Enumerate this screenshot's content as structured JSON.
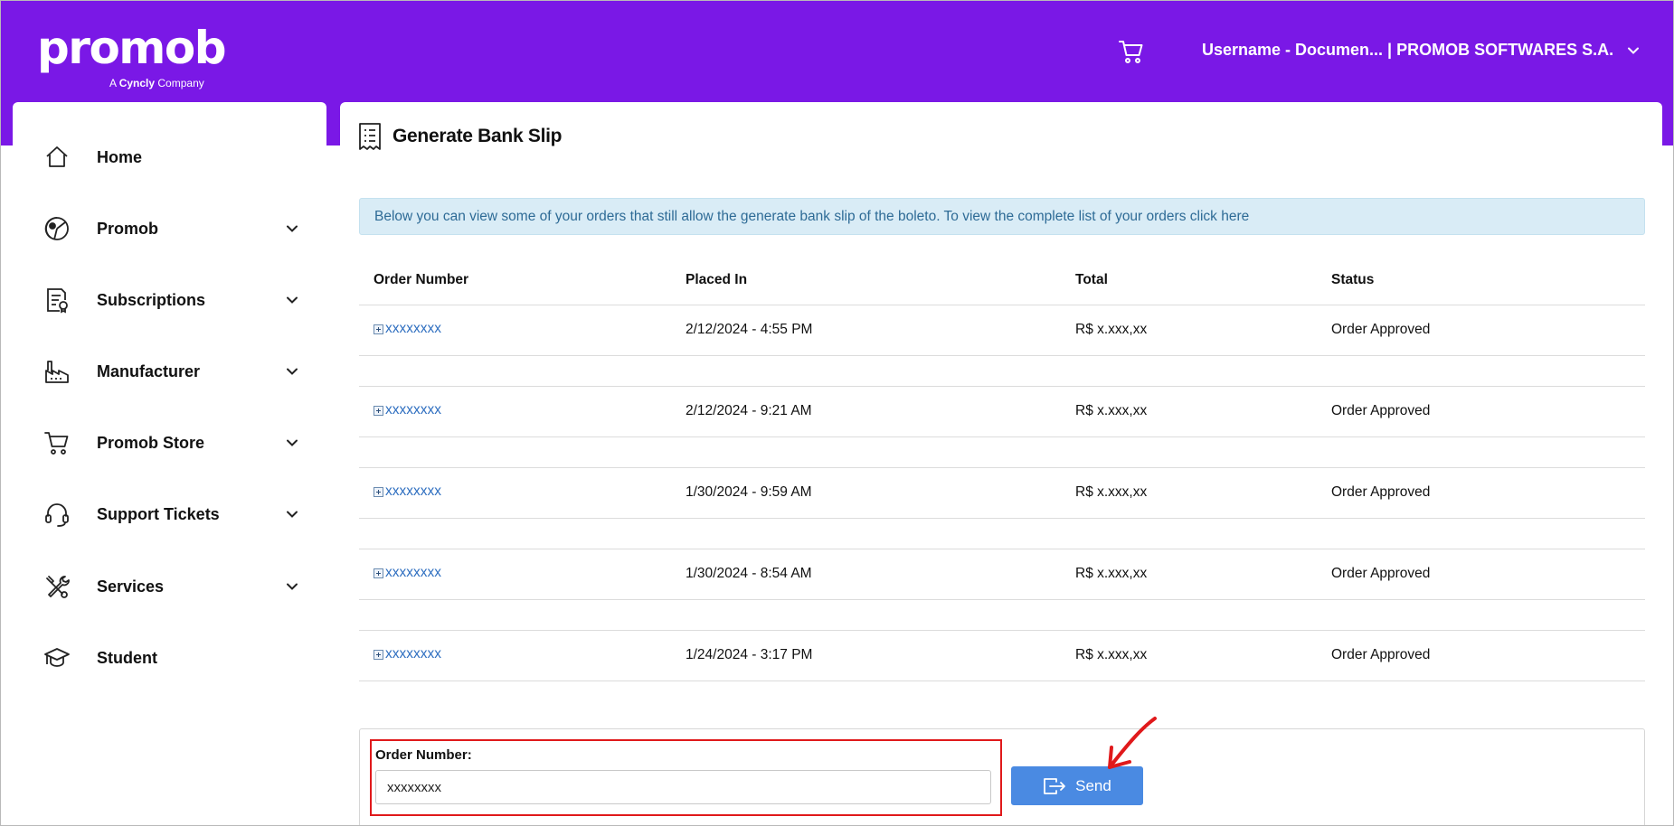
{
  "brand": {
    "logo_text": "promob",
    "tagline_prefix": "A ",
    "tagline_brand": "Cyncly",
    "tagline_suffix": " Company"
  },
  "header": {
    "cart_icon": "cart-icon",
    "account_label": "Username - Documen... | PROMOB SOFTWARES S.A.",
    "account_chevron": "chevron-down-icon"
  },
  "sidebar": {
    "items": [
      {
        "label": "Home",
        "icon": "home-icon",
        "expandable": false
      },
      {
        "label": "Promob",
        "icon": "promob-icon",
        "expandable": true
      },
      {
        "label": "Subscriptions",
        "icon": "subscriptions-icon",
        "expandable": true
      },
      {
        "label": "Manufacturer",
        "icon": "factory-icon",
        "expandable": true
      },
      {
        "label": "Promob Store",
        "icon": "cart-icon",
        "expandable": true
      },
      {
        "label": "Support Tickets",
        "icon": "headset-icon",
        "expandable": true
      },
      {
        "label": "Services",
        "icon": "tools-icon",
        "expandable": true
      },
      {
        "label": "Student",
        "icon": "graduation-cap-icon",
        "expandable": false
      }
    ]
  },
  "main": {
    "title": "Generate Bank Slip",
    "title_icon": "receipt-icon",
    "info_text": "Below you can view some of your orders that still allow the generate bank slip of the boleto. To view the complete list of your orders click here",
    "table": {
      "headers": [
        "Order Number",
        "Placed In",
        "Total",
        "Status"
      ],
      "rows": [
        {
          "order": "xxxxxxxx",
          "placed": "2/12/2024 - 4:55 PM",
          "total": "R$ x.xxx,xx",
          "status": "Order Approved"
        },
        {
          "order": "xxxxxxxx",
          "placed": "2/12/2024 - 9:21 AM",
          "total": "R$ x.xxx,xx",
          "status": "Order Approved"
        },
        {
          "order": "xxxxxxxx",
          "placed": "1/30/2024 - 9:59 AM",
          "total": "R$ x.xxx,xx",
          "status": "Order Approved"
        },
        {
          "order": "xxxxxxxx",
          "placed": "1/30/2024 - 8:54 AM",
          "total": "R$ x.xxx,xx",
          "status": "Order Approved"
        },
        {
          "order": "xxxxxxxx",
          "placed": "1/24/2024 - 3:17 PM",
          "total": "R$ x.xxx,xx",
          "status": "Order Approved"
        }
      ]
    },
    "form": {
      "label": "Order Number:",
      "value": "xxxxxxxx",
      "send_label": "Send"
    }
  },
  "colors": {
    "header_bg": "#7a18e6",
    "info_bg": "#d9ecf6",
    "link": "#2f6fc0",
    "send_button": "#4a8ae2",
    "highlight": "#e0191b"
  }
}
